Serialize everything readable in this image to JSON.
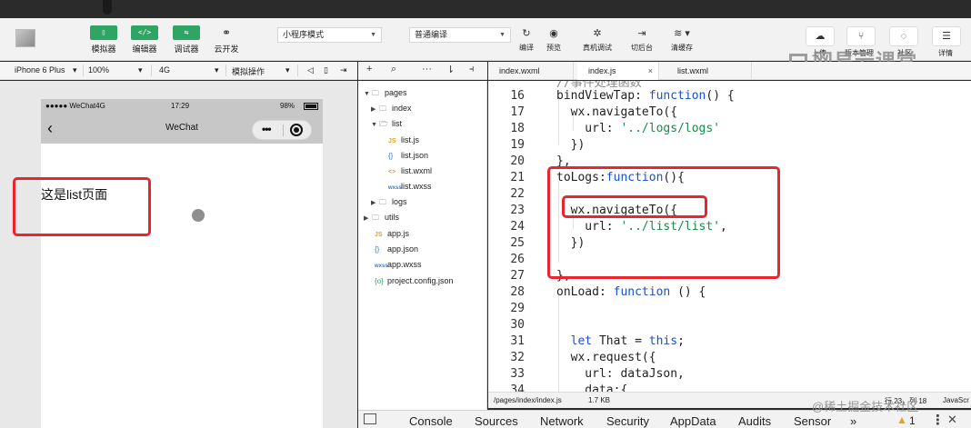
{
  "toolbar": {
    "simulator": "模拟器",
    "editor": "编辑器",
    "debugger": "调试器",
    "cloud": "云开发",
    "mode_select": "小程序模式",
    "compile_select": "普通编译",
    "compile": "编译",
    "preview": "预览",
    "device_debug": "真机调试",
    "background": "切后台",
    "clear_cache": "清缓存",
    "upload": "上传",
    "version": "版本管理",
    "community": "社区",
    "details": "详情"
  },
  "simulator_bar": {
    "device": "iPhone 6 Plus",
    "zoom": "100%",
    "network": "4G",
    "operation": "模拟操作"
  },
  "phone": {
    "carrier": "●●●●● WeChat4G",
    "time": "17:29",
    "battery": "98%",
    "nav_title": "WeChat",
    "page_text": "这是list页面"
  },
  "tree": {
    "items": [
      {
        "label": "pages",
        "type": "folder",
        "arrow": "▼"
      },
      {
        "label": "index",
        "type": "folder",
        "arrow": "▶"
      },
      {
        "label": "list",
        "type": "folder",
        "arrow": "▼"
      },
      {
        "label": "list.js",
        "type": "js",
        "arrow": ""
      },
      {
        "label": "list.json",
        "type": "json",
        "arrow": ""
      },
      {
        "label": "list.wxml",
        "type": "wxml",
        "arrow": ""
      },
      {
        "label": "list.wxss",
        "type": "wxss",
        "arrow": ""
      },
      {
        "label": "logs",
        "type": "folder",
        "arrow": "▶"
      },
      {
        "label": "utils",
        "type": "folder",
        "arrow": "▶"
      },
      {
        "label": "app.js",
        "type": "js",
        "arrow": ""
      },
      {
        "label": "app.json",
        "type": "json",
        "arrow": ""
      },
      {
        "label": "app.wxss",
        "type": "wxss",
        "arrow": ""
      },
      {
        "label": "project.config.json",
        "type": "cfg",
        "arrow": ""
      }
    ]
  },
  "tabs": [
    {
      "label": "index.wxml"
    },
    {
      "label": "index.js",
      "close": "×"
    },
    {
      "label": "list.wxml"
    }
  ],
  "code": {
    "partial_top": "//事件处理函数",
    "lines": [
      {
        "n": "16",
        "text": "bindViewTap: function() {"
      },
      {
        "n": "17",
        "text": "  wx.navigateTo({"
      },
      {
        "n": "18",
        "text": "    url: '../logs/logs'"
      },
      {
        "n": "19",
        "text": "  })"
      },
      {
        "n": "20",
        "text": "},"
      },
      {
        "n": "21",
        "text": "toLogs:function(){"
      },
      {
        "n": "22",
        "text": ""
      },
      {
        "n": "23",
        "text": "  wx.navigateTo({"
      },
      {
        "n": "24",
        "text": "    url: '../list/list',"
      },
      {
        "n": "25",
        "text": "  })"
      },
      {
        "n": "26",
        "text": ""
      },
      {
        "n": "27",
        "text": "},"
      },
      {
        "n": "28",
        "text": "onLoad: function () {"
      },
      {
        "n": "29",
        "text": ""
      },
      {
        "n": "30",
        "text": ""
      },
      {
        "n": "31",
        "text": "  let That = this;"
      },
      {
        "n": "32",
        "text": "  wx.request({"
      },
      {
        "n": "33",
        "text": "    url: dataJson,"
      },
      {
        "n": "34",
        "text": "    data:{"
      }
    ]
  },
  "editor_status": {
    "path": "/pages/index/index.js",
    "size": "1.7 KB",
    "position": "行 23，列 18",
    "language": "JavaScr"
  },
  "devtools": {
    "tabs": [
      "Console",
      "Sources",
      "Network",
      "Security",
      "AppData",
      "Audits",
      "Sensor"
    ],
    "more": "»",
    "warning_count": "1"
  },
  "watermarks": {
    "top": "网易云课堂",
    "bottom": "@稀土掘金技术社区"
  }
}
